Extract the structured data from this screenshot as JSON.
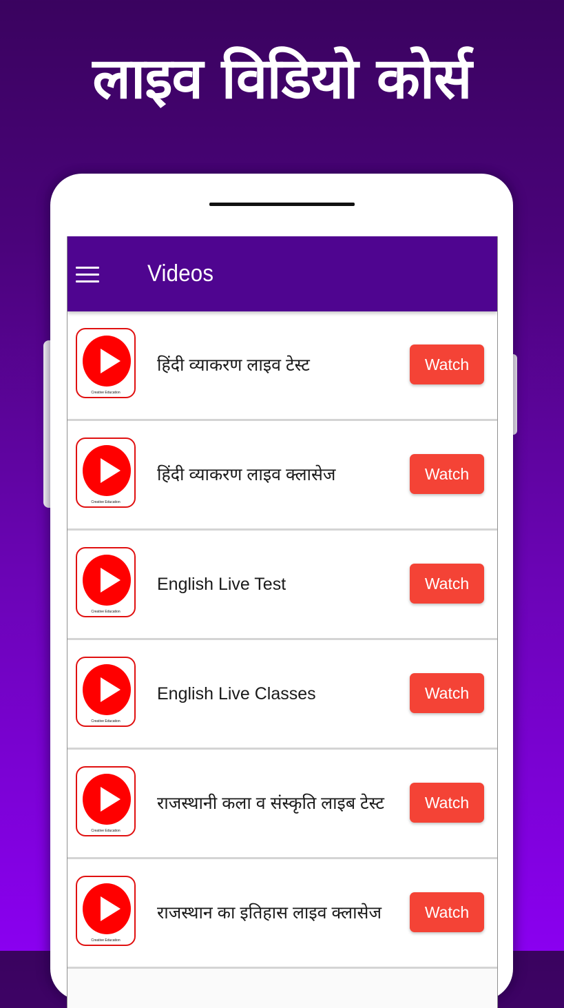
{
  "headline": "लाइव विडियो कोर्स",
  "app": {
    "title": "Videos",
    "menu_icon": "hamburger-menu-icon"
  },
  "colors": {
    "appbar": "#4F0590",
    "watch_button": "#F44336",
    "thumbnail_play": "#FF0000"
  },
  "videos": [
    {
      "title": "हिंदी व्याकरण लाइव टेस्ट",
      "button": "Watch",
      "thumb_caption": "Creative Education",
      "icon": "play-icon"
    },
    {
      "title": "हिंदी व्याकरण लाइव क्लासेज",
      "button": "Watch",
      "thumb_caption": "Creative Education",
      "icon": "play-icon"
    },
    {
      "title": "English Live Test",
      "button": "Watch",
      "thumb_caption": "Creative Education",
      "icon": "play-icon"
    },
    {
      "title": "English Live Classes",
      "button": "Watch",
      "thumb_caption": "Creative Education",
      "icon": "play-icon"
    },
    {
      "title": "राजस्थानी कला व संस्कृति लाइब टेस्ट",
      "button": "Watch",
      "thumb_caption": "Creative Education",
      "icon": "play-icon"
    },
    {
      "title": "राजस्थान का इतिहास लाइव क्लासेज",
      "button": "Watch",
      "thumb_caption": "Creative Education",
      "icon": "play-icon"
    }
  ]
}
